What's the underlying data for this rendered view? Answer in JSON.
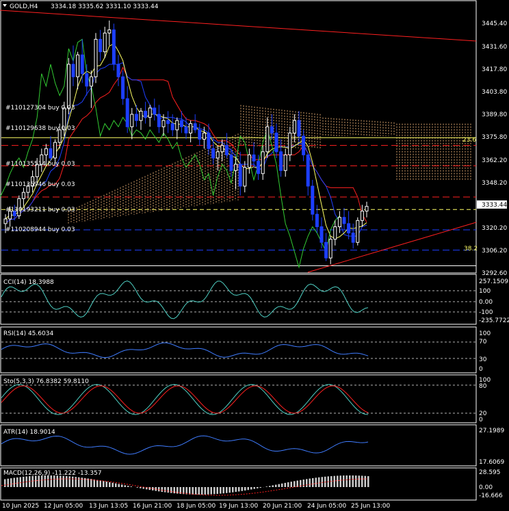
{
  "header": {
    "symbol_tf": "GOLD,H4",
    "ohlc": "3334.18 3335.62 3331.10 3333.44"
  },
  "colors": {
    "up": "#ffffff",
    "down": "#1d3fff",
    "ma": "#ffff66",
    "kijun": "#ff2020",
    "tenkan": "#2040ff",
    "chikou": "#33cc33",
    "cloud": "#ffc080",
    "trend": "#ff2020",
    "grid": "#ffffff",
    "panel_border": "#ffffff"
  },
  "price_axis": {
    "ticks": [
      "3445.40",
      "3431.60",
      "3417.80",
      "3403.80",
      "3389.80",
      "3375.80",
      "3362.20",
      "3348.20",
      "3320.20",
      "3306.20",
      "3292.60"
    ],
    "current_price": "3333.44"
  },
  "fib_labels": {
    "fib_236": "23.6",
    "fib_382": "38.2"
  },
  "trades": [
    "#110127304 buy 0.03",
    "#110129638 buy 0.03",
    "#110135514 buy 0.03",
    "#110135946 buy 0.03",
    "#110193211 buy 0.03",
    "#110208944 buy 0.03"
  ],
  "indicators": {
    "cci": {
      "label": "CCI(14) 18.3988",
      "ticks": [
        "257.1509",
        "100",
        "0.00",
        "-100",
        "-235.7722"
      ]
    },
    "rsi": {
      "label": "RSI(14) 45.6034",
      "ticks": [
        "100",
        "70",
        "30",
        "0"
      ]
    },
    "sto": {
      "label": "Sto(5,3,3) 76.8382 59.8110",
      "ticks": [
        "100",
        "80",
        "20",
        "0"
      ]
    },
    "atr": {
      "label": "ATR(14) 18.9014",
      "ticks": [
        "27.1989",
        "17.6069"
      ]
    },
    "macd": {
      "label": "MACD(12,26,9) -11.222 -13.357",
      "ticks": [
        "28.595",
        "0.00",
        "-16.666"
      ]
    }
  },
  "time_axis": [
    "10 Jun 2025",
    "12 Jun 05:00",
    "13 Jun 13:05",
    "16 Jun 21:00",
    "18 Jun 05:00",
    "19 Jun 13:00",
    "20 Jun 21:00",
    "24 Jun 05:00",
    "25 Jun 13:00"
  ],
  "chart_data": {
    "type": "candlestick",
    "ylim": [
      3292.6,
      3452
    ],
    "candles": [
      [
        3322,
        3328,
        3316,
        3325
      ],
      [
        3325,
        3333,
        3320,
        3330
      ],
      [
        3330,
        3334,
        3324,
        3327
      ],
      [
        3327,
        3340,
        3325,
        3338
      ],
      [
        3338,
        3345,
        3333,
        3342
      ],
      [
        3342,
        3348,
        3338,
        3346
      ],
      [
        3346,
        3356,
        3342,
        3352
      ],
      [
        3352,
        3364,
        3348,
        3360
      ],
      [
        3360,
        3370,
        3355,
        3366
      ],
      [
        3366,
        3373,
        3359,
        3370
      ],
      [
        3370,
        3378,
        3362,
        3364
      ],
      [
        3364,
        3376,
        3360,
        3374
      ],
      [
        3374,
        3386,
        3370,
        3382
      ],
      [
        3382,
        3400,
        3378,
        3396
      ],
      [
        3396,
        3428,
        3392,
        3424
      ],
      [
        3424,
        3436,
        3410,
        3416
      ],
      [
        3416,
        3432,
        3408,
        3430
      ],
      [
        3430,
        3440,
        3412,
        3418
      ],
      [
        3418,
        3424,
        3404,
        3410
      ],
      [
        3410,
        3420,
        3396,
        3416
      ],
      [
        3416,
        3444,
        3412,
        3440
      ],
      [
        3440,
        3446,
        3426,
        3432
      ],
      [
        3432,
        3448,
        3428,
        3444
      ],
      [
        3444,
        3452,
        3436,
        3446
      ],
      [
        3446,
        3450,
        3420,
        3424
      ],
      [
        3424,
        3430,
        3410,
        3416
      ],
      [
        3416,
        3420,
        3398,
        3402
      ],
      [
        3402,
        3410,
        3380,
        3384
      ],
      [
        3384,
        3396,
        3376,
        3392
      ],
      [
        3392,
        3398,
        3384,
        3388
      ],
      [
        3388,
        3396,
        3382,
        3394
      ],
      [
        3394,
        3400,
        3386,
        3390
      ],
      [
        3390,
        3398,
        3384,
        3396
      ],
      [
        3396,
        3402,
        3388,
        3392
      ],
      [
        3392,
        3398,
        3380,
        3384
      ],
      [
        3384,
        3392,
        3378,
        3388
      ],
      [
        3388,
        3394,
        3380,
        3386
      ],
      [
        3386,
        3392,
        3378,
        3382
      ],
      [
        3382,
        3390,
        3376,
        3388
      ],
      [
        3388,
        3394,
        3380,
        3384
      ],
      [
        3384,
        3390,
        3376,
        3380
      ],
      [
        3380,
        3388,
        3374,
        3386
      ],
      [
        3386,
        3392,
        3380,
        3382
      ],
      [
        3382,
        3386,
        3372,
        3376
      ],
      [
        3376,
        3384,
        3370,
        3380
      ],
      [
        3380,
        3386,
        3366,
        3370
      ],
      [
        3370,
        3376,
        3360,
        3364
      ],
      [
        3364,
        3372,
        3356,
        3368
      ],
      [
        3368,
        3376,
        3362,
        3372
      ],
      [
        3372,
        3380,
        3364,
        3366
      ],
      [
        3366,
        3370,
        3352,
        3356
      ],
      [
        3356,
        3364,
        3344,
        3360
      ],
      [
        3360,
        3368,
        3340,
        3346
      ],
      [
        3346,
        3362,
        3342,
        3358
      ],
      [
        3358,
        3370,
        3354,
        3366
      ],
      [
        3366,
        3374,
        3358,
        3362
      ],
      [
        3362,
        3366,
        3350,
        3354
      ],
      [
        3354,
        3372,
        3350,
        3368
      ],
      [
        3368,
        3390,
        3364,
        3384
      ],
      [
        3384,
        3392,
        3376,
        3380
      ],
      [
        3380,
        3386,
        3364,
        3368
      ],
      [
        3368,
        3376,
        3352,
        3356
      ],
      [
        3356,
        3370,
        3352,
        3366
      ],
      [
        3366,
        3384,
        3362,
        3380
      ],
      [
        3380,
        3392,
        3374,
        3388
      ],
      [
        3388,
        3394,
        3374,
        3378
      ],
      [
        3378,
        3382,
        3362,
        3366
      ],
      [
        3366,
        3360,
        3340,
        3346
      ],
      [
        3346,
        3350,
        3324,
        3328
      ],
      [
        3328,
        3334,
        3316,
        3320
      ],
      [
        3320,
        3326,
        3306,
        3310
      ],
      [
        3310,
        3316,
        3298,
        3300
      ],
      [
        3300,
        3314,
        3296,
        3312
      ],
      [
        3312,
        3324,
        3308,
        3320
      ],
      [
        3320,
        3330,
        3316,
        3326
      ],
      [
        3326,
        3332,
        3318,
        3322
      ],
      [
        3322,
        3330,
        3312,
        3316
      ],
      [
        3316,
        3322,
        3306,
        3310
      ],
      [
        3310,
        3326,
        3308,
        3324
      ],
      [
        3324,
        3334,
        3320,
        3330
      ],
      [
        3330,
        3336,
        3326,
        3333
      ]
    ]
  }
}
